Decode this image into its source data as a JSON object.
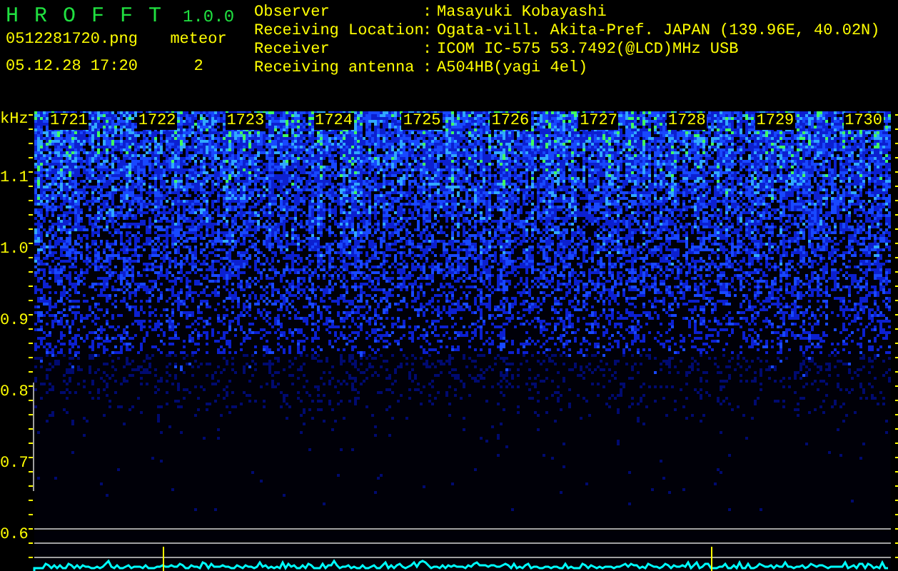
{
  "app": {
    "name": "H R O F F T",
    "version": "1.0.0"
  },
  "file": {
    "name": "0512281720.png",
    "datetime": "05.12.28 17:20"
  },
  "meteor": {
    "label": "meteor",
    "count": "2"
  },
  "info": [
    {
      "label": "Observer",
      "separator": ":",
      "value": "Masayuki Kobayashi"
    },
    {
      "label": "Receiving Location",
      "separator": ":",
      "value": "Ogata-vill. Akita-Pref. JAPAN (139.96E, 40.02N)"
    },
    {
      "label": "Receiver",
      "separator": ":",
      "value": "ICOM IC-575 53.7492(@LCD)MHz USB"
    },
    {
      "label": "Receiving antenna",
      "separator": ":",
      "value": "A504HB(yagi 4el)"
    }
  ],
  "spectrogram": {
    "y_unit": "kHz",
    "y_labels": [
      "1.1",
      "1.0",
      "0.9",
      "0.8",
      "0.7",
      "0.6"
    ],
    "time_labels": [
      "1721",
      "1722",
      "1723",
      "1724",
      "1725",
      "1726",
      "1727",
      "1728",
      "1729",
      "1730"
    ]
  }
}
